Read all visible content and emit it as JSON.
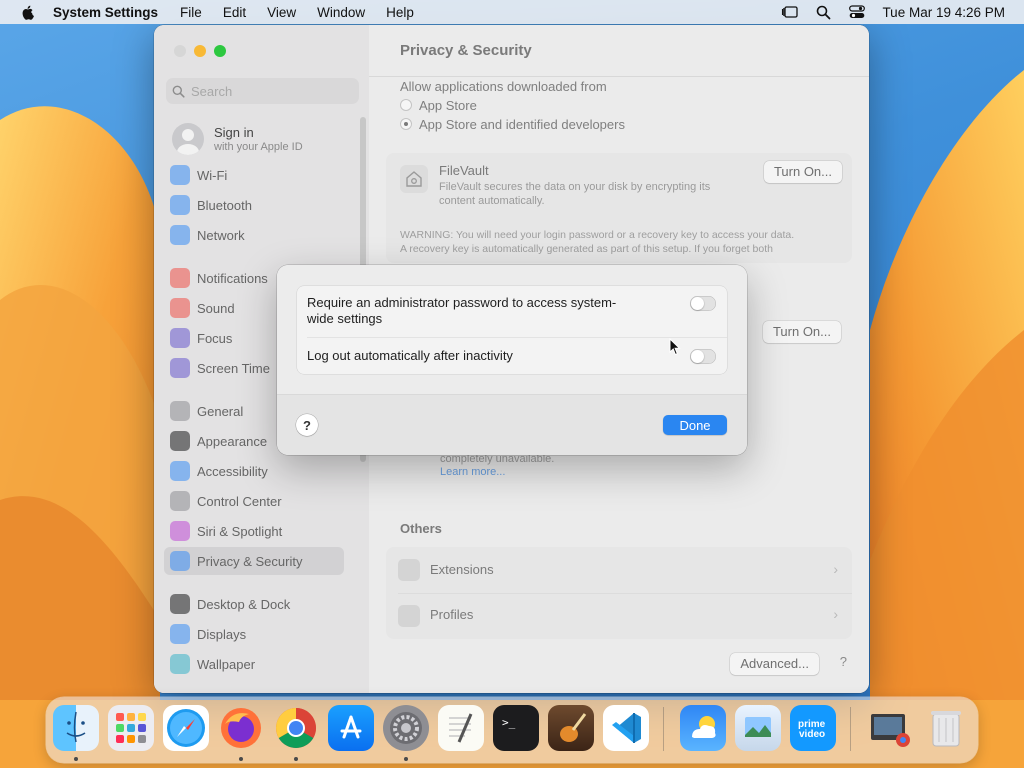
{
  "menubar": {
    "app_name": "System Settings",
    "items": [
      "File",
      "Edit",
      "View",
      "Window",
      "Help"
    ],
    "clock": "Tue Mar 19  4:26 PM"
  },
  "window": {
    "title": "Privacy & Security",
    "search_placeholder": "Search",
    "account": {
      "title": "Sign in",
      "subtitle": "with your Apple ID"
    },
    "sidebar": {
      "items": [
        {
          "label": "Wi-Fi",
          "icon": "wifi-icon",
          "color": "#3b8ef5"
        },
        {
          "label": "Bluetooth",
          "icon": "bluetooth-icon",
          "color": "#3b8ef5"
        },
        {
          "label": "Network",
          "icon": "globe-icon",
          "color": "#3b8ef5"
        },
        {
          "label": "Notifications",
          "icon": "bell-icon",
          "color": "#f0524a"
        },
        {
          "label": "Sound",
          "icon": "speaker-icon",
          "color": "#f0524a"
        },
        {
          "label": "Focus",
          "icon": "moon-icon",
          "color": "#6a5acd"
        },
        {
          "label": "Screen Time",
          "icon": "hourglass-icon",
          "color": "#6a5acd"
        },
        {
          "label": "General",
          "icon": "gear-icon",
          "color": "#8e8e93"
        },
        {
          "label": "Appearance",
          "icon": "appearance-icon",
          "color": "#1c1c1e"
        },
        {
          "label": "Accessibility",
          "icon": "accessibility-icon",
          "color": "#3b8ef5"
        },
        {
          "label": "Control Center",
          "icon": "control-center-icon",
          "color": "#8e8e93"
        },
        {
          "label": "Siri & Spotlight",
          "icon": "siri-icon",
          "color": "#c04bd6"
        },
        {
          "label": "Privacy & Security",
          "icon": "hand-icon",
          "color": "#3b8ef5"
        },
        {
          "label": "Desktop & Dock",
          "icon": "dock-icon",
          "color": "#1c1c1e"
        },
        {
          "label": "Displays",
          "icon": "display-icon",
          "color": "#3b8ef5"
        },
        {
          "label": "Wallpaper",
          "icon": "wallpaper-icon",
          "color": "#3bb3c9"
        }
      ],
      "active_index": 12
    },
    "content": {
      "allow_heading": "Allow applications downloaded from",
      "radio_app_store": "App Store",
      "radio_identified": "App Store and identified developers",
      "filevault_title": "FileVault",
      "filevault_desc_1": "FileVault secures the data on your disk by encrypting its",
      "filevault_desc_2": "content automatically.",
      "turn_on_1": "Turn On...",
      "warning_1": "WARNING: You will need your login password or a recovery key to access your data.",
      "warning_2": "A recovery key is automatically generated as part of this setup. If you forget both",
      "turn_on_2": "Turn On...",
      "unavailable": "completely unavailable.",
      "learn_more": "Learn more...",
      "others_heading": "Others",
      "extensions": "Extensions",
      "profiles": "Profiles",
      "advanced": "Advanced...",
      "help": "?"
    }
  },
  "sheet": {
    "option_1": "Require an administrator password to access system-wide settings",
    "option_2": "Log out automatically after inactivity",
    "option_1_on": false,
    "option_2_on": false,
    "help": "?",
    "done": "Done"
  },
  "dock": {
    "apps": [
      "Finder",
      "Launchpad",
      "Safari",
      "Firefox",
      "Chrome",
      "App Store",
      "System Settings",
      "TextEdit",
      "Terminal",
      "GarageBand",
      "Visual Studio Code",
      "Weather",
      "Preview",
      "Prime Video",
      "Screenshot",
      "Trash"
    ]
  }
}
